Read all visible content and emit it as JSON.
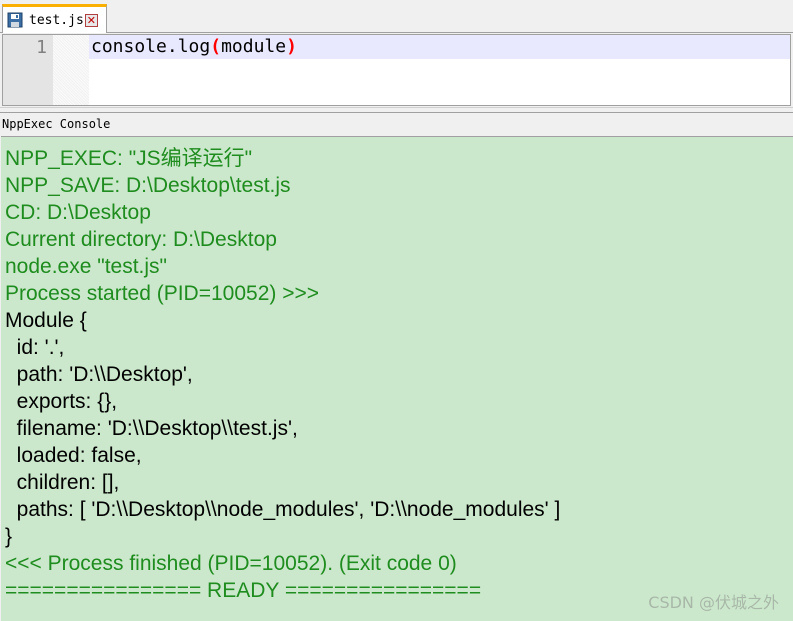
{
  "tab": {
    "label": "test.js",
    "close_glyph": "✕",
    "save_icon": "floppy-disk-icon",
    "accent": "#fab000"
  },
  "editor": {
    "line_number": "1",
    "code_prefix": "console.log",
    "open_paren": "(",
    "code_arg": "module",
    "close_paren": ")"
  },
  "console": {
    "title": "NppExec Console",
    "background": "#cce8cc",
    "text_green": "#1e8c1e",
    "lines": [
      "NPP_EXEC: \"JS编译运行\"",
      "NPP_SAVE: D:\\Desktop\\test.js",
      "CD: D:\\Desktop",
      "Current directory: D:\\Desktop",
      "node.exe \"test.js\"",
      "Process started (PID=10052) >>>",
      "Module {",
      "  id: '.',",
      "  path: 'D:\\\\Desktop',",
      "  exports: {},",
      "  filename: 'D:\\\\Desktop\\\\test.js',",
      "  loaded: false,",
      "  children: [],",
      "  paths: [ 'D:\\\\Desktop\\\\node_modules', 'D:\\\\node_modules' ]",
      "}",
      "<<< Process finished (PID=10052). (Exit code 0)",
      "================ READY ================"
    ]
  },
  "watermark": "CSDN @伏城之外"
}
